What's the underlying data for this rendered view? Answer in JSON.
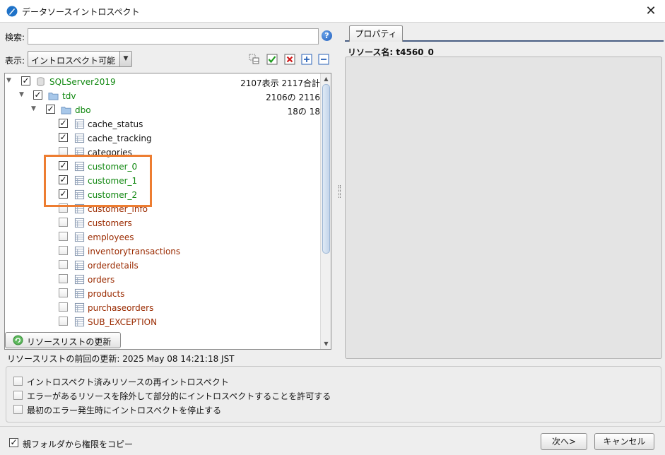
{
  "window": {
    "title": "データソースイントロスペクト",
    "close": "✕"
  },
  "search": {
    "label": "検索:",
    "value": "",
    "placeholder": "",
    "help": "?"
  },
  "view": {
    "label": "表示:",
    "selected": "イントロスペクト可能"
  },
  "tree": {
    "root": {
      "label": "SQLServer2019",
      "count": "2107表示 2117合計",
      "checked": true,
      "color": "#118811"
    },
    "catalog": {
      "label": "tdv",
      "count": "2106の 2116",
      "checked": true
    },
    "schema": {
      "label": "dbo",
      "count": "18の 18",
      "checked": true
    },
    "tables": [
      {
        "label": "cache_status",
        "checked": true,
        "style": "black"
      },
      {
        "label": "cache_tracking",
        "checked": true,
        "style": "black"
      },
      {
        "label": "categories",
        "checked": false,
        "style": "black"
      },
      {
        "label": "customer_0",
        "checked": true,
        "style": "green"
      },
      {
        "label": "customer_1",
        "checked": true,
        "style": "green"
      },
      {
        "label": "customer_2",
        "checked": true,
        "style": "green"
      },
      {
        "label": "customer_info",
        "checked": false,
        "style": "red"
      },
      {
        "label": "customers",
        "checked": false,
        "style": "red"
      },
      {
        "label": "employees",
        "checked": false,
        "style": "red"
      },
      {
        "label": "inventorytransactions",
        "checked": false,
        "style": "red"
      },
      {
        "label": "orderdetails",
        "checked": false,
        "style": "red"
      },
      {
        "label": "orders",
        "checked": false,
        "style": "red"
      },
      {
        "label": "products",
        "checked": false,
        "style": "red"
      },
      {
        "label": "purchaseorders",
        "checked": false,
        "style": "red"
      },
      {
        "label": "SUB_EXCEPTION",
        "checked": false,
        "style": "red"
      }
    ]
  },
  "refresh": {
    "button_label": "リソースリストの更新",
    "last_updated": "リソースリストの前回の更新: 2025 May 08 14:21:18 JST"
  },
  "properties": {
    "tab_label": "プロパティ",
    "resource_name": "リソース名: t4560_0"
  },
  "options": [
    {
      "label": "イントロスペクト済みリソースの再イントロスペクト",
      "checked": false
    },
    {
      "label": "エラーがあるリソースを除外して部分的にイントロスペクトすることを許可する",
      "checked": false
    },
    {
      "label": "最初のエラー発生時にイントロスペクトを停止する",
      "checked": false
    }
  ],
  "footer": {
    "copy_permissions": {
      "label": "親フォルダから権限をコピー",
      "checked": true
    },
    "next_label": "次へ>",
    "cancel_label": "キャンセル"
  },
  "colors": {
    "highlight": "#ed7d31",
    "included_text": "#118811",
    "excluded_text": "#9a2a00"
  },
  "icons": [
    "app-icon",
    "help-icon",
    "database-icon",
    "folder-icon",
    "table-icon",
    "refresh-icon",
    "select-children-icon",
    "check-all-icon",
    "uncheck-all-icon",
    "expand-all-icon",
    "collapse-all-icon"
  ]
}
